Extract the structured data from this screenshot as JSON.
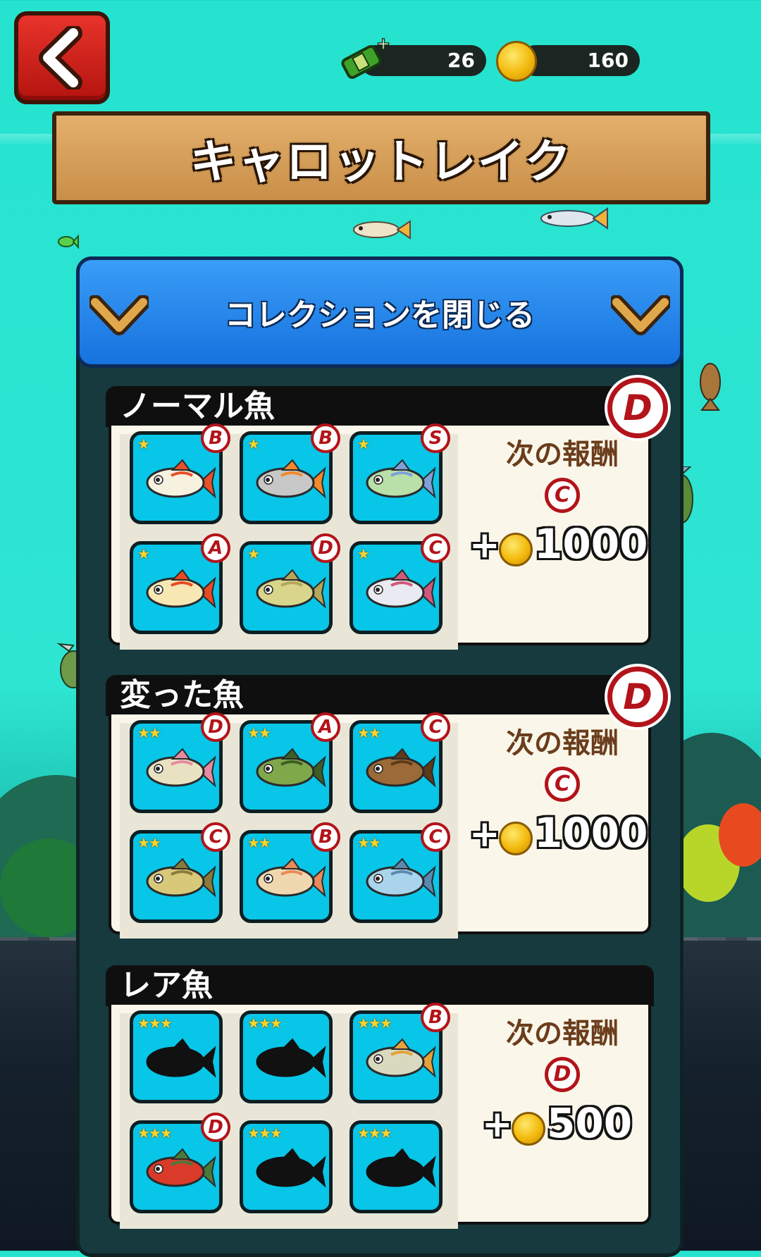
{
  "currency": {
    "gems": "26",
    "coins": "160"
  },
  "title": "キャロットレイク",
  "close_label": "コレクションを閉じる",
  "sections": [
    {
      "title": "ノーマル魚",
      "rank": "D",
      "next_reward_label": "次の報酬",
      "next_reward_rank": "C",
      "reward_plus": "+",
      "reward_amount": "1000",
      "tiles": [
        {
          "stars": "★",
          "rank": "B",
          "fish": "goldfish",
          "color": "#f7f2e0",
          "accent": "#e7512b",
          "silhouette": false
        },
        {
          "stars": "★",
          "rank": "B",
          "fish": "minnow",
          "color": "#c7c7c7",
          "accent": "#f08a2a",
          "silhouette": false
        },
        {
          "stars": "★",
          "rank": "S",
          "fish": "dace",
          "color": "#b8e0a8",
          "accent": "#7fa0d8",
          "silhouette": false
        },
        {
          "stars": "★",
          "rank": "A",
          "fish": "perch",
          "color": "#f6e7b3",
          "accent": "#e94a24",
          "silhouette": false
        },
        {
          "stars": "★",
          "rank": "D",
          "fish": "crucian",
          "color": "#d9d58a",
          "accent": "#b3a75a",
          "silhouette": false
        },
        {
          "stars": "★",
          "rank": "C",
          "fish": "silver-carp",
          "color": "#eaeaf2",
          "accent": "#d05a7a",
          "silhouette": false
        }
      ]
    },
    {
      "title": "変った魚",
      "rank": "D",
      "next_reward_label": "次の報酬",
      "next_reward_rank": "C",
      "reward_plus": "+",
      "reward_amount": "1000",
      "tiles": [
        {
          "stars": "★★",
          "rank": "D",
          "fish": "trout",
          "color": "#e8e2c2",
          "accent": "#e88aa0",
          "silhouette": false
        },
        {
          "stars": "★★",
          "rank": "A",
          "fish": "bass",
          "color": "#7fa84a",
          "accent": "#3d5e26",
          "silhouette": false
        },
        {
          "stars": "★★",
          "rank": "C",
          "fish": "carp",
          "color": "#9b6a38",
          "accent": "#5c3a1a",
          "silhouette": false
        },
        {
          "stars": "★★",
          "rank": "C",
          "fish": "zander",
          "color": "#d8c97a",
          "accent": "#8a7a3a",
          "silhouette": false
        },
        {
          "stars": "★★",
          "rank": "B",
          "fish": "char",
          "color": "#efd8b0",
          "accent": "#e88a5a",
          "silhouette": false
        },
        {
          "stars": "★★",
          "rank": "C",
          "fish": "salmon",
          "color": "#a9d4ec",
          "accent": "#5a8ab0",
          "silhouette": false
        }
      ]
    },
    {
      "title": "レア魚",
      "rank": "",
      "next_reward_label": "次の報酬",
      "next_reward_rank": "D",
      "reward_plus": "+",
      "reward_amount": "500",
      "tiles": [
        {
          "stars": "★★★",
          "rank": "",
          "fish": "catfish",
          "color": "#111111",
          "accent": "#111111",
          "silhouette": true
        },
        {
          "stars": "★★★",
          "rank": "",
          "fish": "sturgeon",
          "color": "#111111",
          "accent": "#111111",
          "silhouette": true
        },
        {
          "stars": "★★★",
          "rank": "B",
          "fish": "grayling",
          "color": "#d9d9c0",
          "accent": "#e5a23a",
          "silhouette": false
        },
        {
          "stars": "★★★",
          "rank": "D",
          "fish": "sockeye",
          "color": "#d93a2a",
          "accent": "#4a7a3a",
          "silhouette": false
        },
        {
          "stars": "★★★",
          "rank": "",
          "fish": "bighead-carp",
          "color": "#111111",
          "accent": "#111111",
          "silhouette": true
        },
        {
          "stars": "★★★",
          "rank": "",
          "fish": "pike",
          "color": "#111111",
          "accent": "#111111",
          "silhouette": true
        }
      ]
    }
  ]
}
